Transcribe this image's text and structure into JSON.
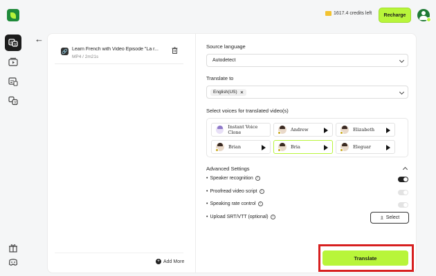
{
  "header": {
    "credits_text": "1617.4 credits left",
    "recharge_label": "Recharge"
  },
  "sidebar": {
    "items": [
      {
        "name": "video-translate",
        "active": true
      },
      {
        "name": "video-player"
      },
      {
        "name": "subtitles"
      },
      {
        "name": "translate"
      }
    ],
    "bottom": [
      "gift",
      "discord"
    ]
  },
  "file": {
    "title": "Learn French with Video Episode \"La r...",
    "meta": "MP4 / 2m21s"
  },
  "add_more_label": "Add More",
  "source_language": {
    "label": "Source language",
    "value": "Autodetect"
  },
  "translate_to": {
    "label": "Translate to",
    "tags": [
      "English(US)"
    ]
  },
  "voices": {
    "label": "Select voices for translated video(s)",
    "items": [
      {
        "name": "Instant Voice Clone",
        "selected": false
      },
      {
        "name": "Andrew",
        "selected": false
      },
      {
        "name": "Elizabeth",
        "selected": false
      },
      {
        "name": "Brian",
        "selected": false
      },
      {
        "name": "Bria",
        "selected": true
      },
      {
        "name": "Eleguar",
        "selected": false
      }
    ]
  },
  "advanced": {
    "title": "Advanced Settings",
    "options": [
      {
        "label": "Speaker recognition",
        "prefix": "•",
        "on": true
      },
      {
        "label": "Proofread video script",
        "prefix": "•",
        "on": false
      },
      {
        "label": "Speaking rate control",
        "prefix": "•",
        "on": false
      }
    ],
    "upload_label": "Upload SRT/VTT (optional)",
    "select_label": "Select"
  },
  "translate_label": "Translate",
  "colors": {
    "accent": "#b8f53a",
    "highlight": "#d71f1f",
    "brand": "#1f8a3a"
  }
}
